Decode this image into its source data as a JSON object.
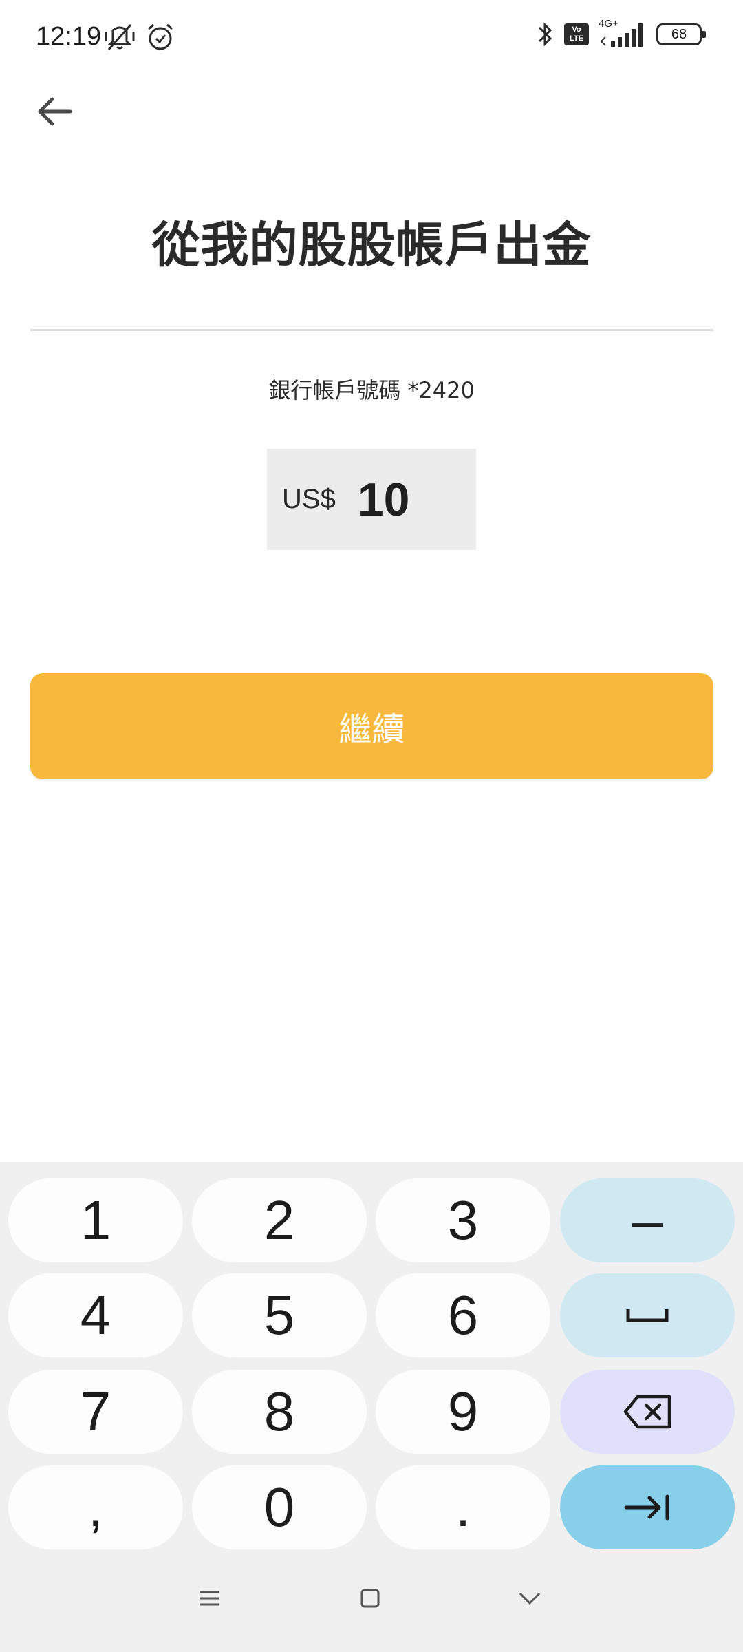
{
  "status_bar": {
    "time": "12:19",
    "network": "4G+",
    "volte_top": "Vo",
    "volte_bottom": "LTE",
    "battery": "68"
  },
  "header": {
    "title": "從我的股股帳戶出金"
  },
  "withdraw": {
    "account_label": "銀行帳戶號碼 *2420",
    "currency": "US$",
    "amount": "10",
    "continue_label": "繼續"
  },
  "keyboard": {
    "keys": [
      "1",
      "2",
      "3",
      "–",
      "4",
      "5",
      "6",
      "7",
      "8",
      "9",
      ",",
      "0",
      "."
    ]
  },
  "colors": {
    "accent": "#f8b73d",
    "key_special": "#d0e8f2",
    "key_delete": "#e0e0fb",
    "key_enter": "#88d0ea"
  }
}
